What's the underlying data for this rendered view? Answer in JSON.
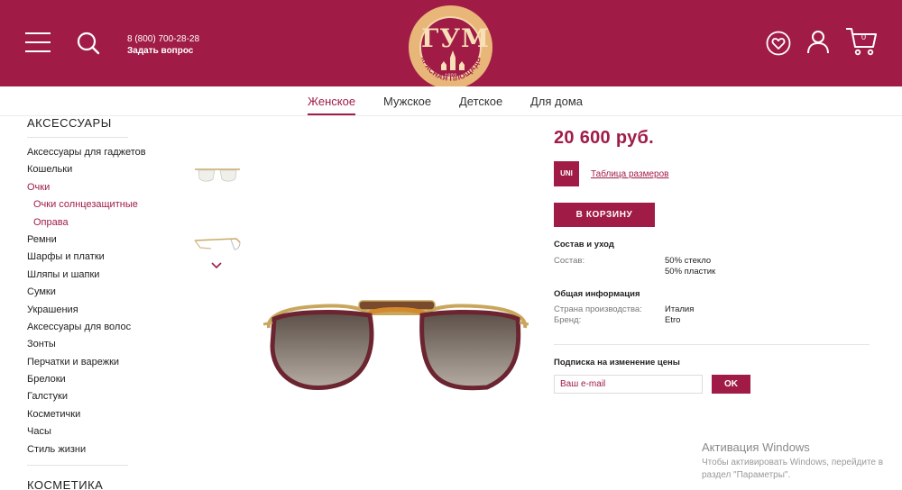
{
  "header": {
    "phone": "8 (800) 700-28-28",
    "ask": "Задать вопрос",
    "logo": {
      "text": "ГУМ",
      "year": "1893",
      "ring_text": "КРАСНАЯ ПЛОЩАДЬ"
    },
    "cart_count": "0",
    "color": "#a01c47"
  },
  "nav": {
    "items": [
      "Женское",
      "Мужское",
      "Детское",
      "Для дома"
    ],
    "active": "Женское"
  },
  "sidebar": {
    "title": "АКСЕССУАРЫ",
    "items": [
      "Аксессуары для гаджетов",
      "Кошельки",
      "Очки",
      "Очки солнцезащитные",
      "Оправа",
      "Ремни",
      "Шарфы и платки",
      "Шляпы и шапки",
      "Сумки",
      "Украшения",
      "Аксессуары для волос",
      "Зонты",
      "Перчатки и варежки",
      "Брелоки",
      "Галстуки",
      "Косметички",
      "Часы",
      "Стиль жизни"
    ],
    "next_title": "КОСМЕТИКА"
  },
  "product": {
    "price": "20 600 руб.",
    "size": "UNI",
    "size_table": "Таблица размеров",
    "add_to_cart": "В КОРЗИНУ",
    "care_title": "Состав и уход",
    "composition_label": "Состав:",
    "composition": [
      "50% стекло",
      "50% пластик"
    ],
    "info_title": "Общая информация",
    "country_label": "Страна производства:",
    "country": "Италия",
    "brand_label": "Бренд:",
    "brand": "Etro"
  },
  "subscribe": {
    "title": "Подписка на изменение цены",
    "placeholder": "Ваш e-mail",
    "ok": "OK"
  },
  "watermark": {
    "title": "Активация Windows",
    "text": "Чтобы активировать Windows, перейдите в раздел \"Параметры\"."
  }
}
